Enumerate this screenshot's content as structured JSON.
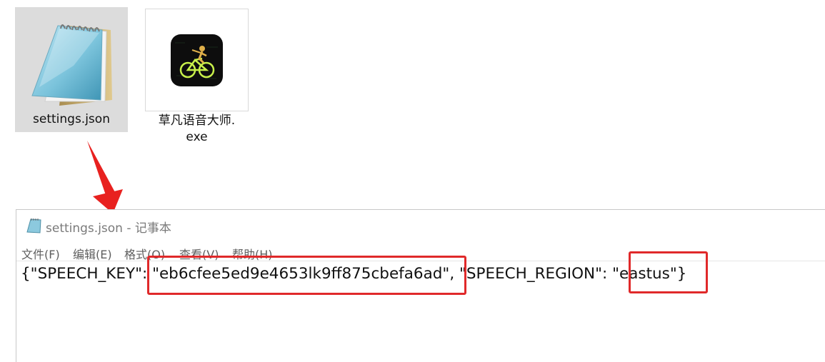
{
  "files": [
    {
      "name": "settings.json",
      "icon": "notepad-icon"
    },
    {
      "name_line1": "草凡语音大师.",
      "name_line2": "exe",
      "icon": "cyclist-app-icon"
    }
  ],
  "notepad": {
    "title": "settings.json - 记事本",
    "menu": [
      "文件(F)",
      "编辑(E)",
      "格式(O)",
      "查看(V)",
      "帮助(H)"
    ],
    "content": {
      "prefix": "{\"SPEECH_KEY\": ",
      "key_value": "\"eb6cfee5ed9e4653lk9ff875cbefa6ad\"",
      "middle": ", \"SPEECH_REGION\": ",
      "region_value": "\"eastus\"",
      "suffix": "}"
    }
  },
  "colors": {
    "highlight": "#e0292a",
    "selection": "#dcdcdc"
  }
}
